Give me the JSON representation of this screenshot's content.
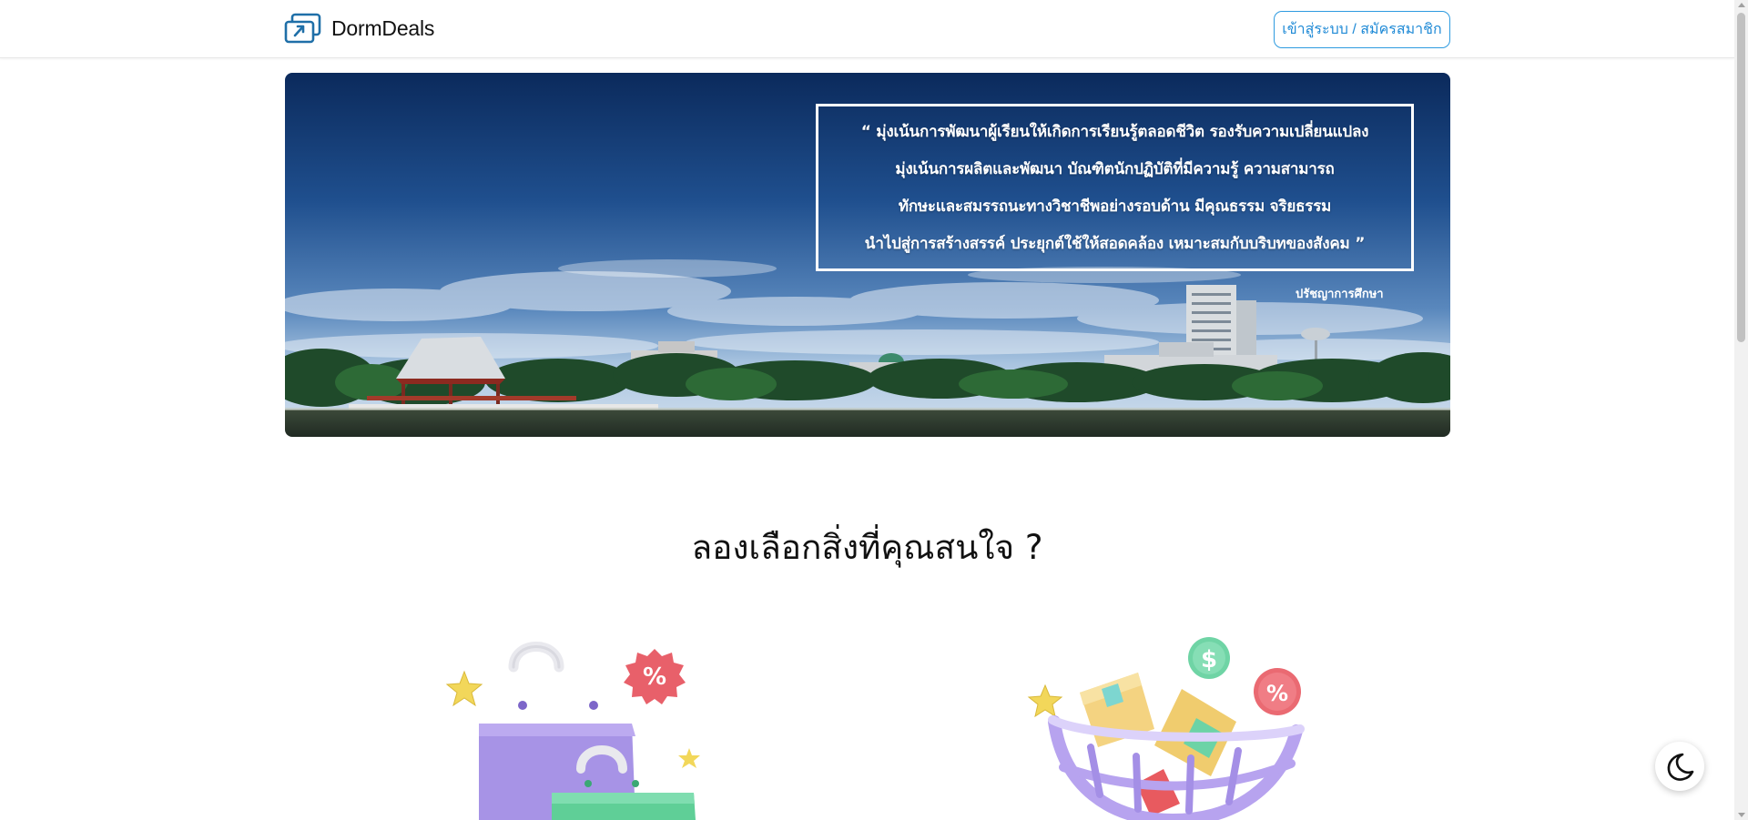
{
  "header": {
    "brand_name": "DormDeals",
    "login_label": "เข้าสู่ระบบ / สมัครสมาชิก"
  },
  "hero": {
    "quote_lines": [
      "“ มุ่งเน้นการพัฒนาผู้เรียนให้เกิดการเรียนรู้ตลอดชีวิต รองรับความเปลี่ยนแปลง",
      "มุ่งเน้นการผลิตและพัฒนา บัณฑิตนักปฏิบัติที่มีความรู้ ความสามารถ",
      "ทักษะและสมรรถนะทางวิชาชีพอย่างรอบด้าน มีคุณธรรม จริยธรรม",
      "นำไปสู่การสร้างสรรค์ ประยุกต์ใช้ให้สอดคล้อง เหมาะสมกับบริบทของสังคม ”"
    ],
    "caption": "ปรัชญาการศึกษา"
  },
  "section": {
    "title": "ลองเลือกสิ่งที่คุณสนใจ ?"
  },
  "icons": {
    "brand": "swap-arrows-icon",
    "theme": "moon-icon",
    "shopping": "shopping-bags-icon",
    "basket": "shopping-basket-icon"
  },
  "colors": {
    "accent": "#2e9be0",
    "brand_icon": "#1f6fa8"
  }
}
